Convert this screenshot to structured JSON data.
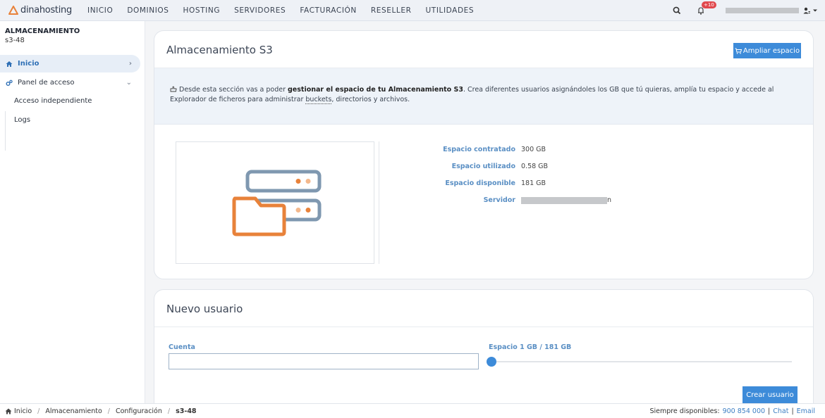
{
  "brand": {
    "name": "dinahosting"
  },
  "nav": {
    "items": [
      {
        "label": "INICIO"
      },
      {
        "label": "DOMINIOS"
      },
      {
        "label": "HOSTING"
      },
      {
        "label": "SERVIDORES"
      },
      {
        "label": "FACTURACIÓN"
      },
      {
        "label": "RESELLER"
      },
      {
        "label": "UTILIDADES"
      }
    ],
    "notifications_badge": "+10"
  },
  "sidebar": {
    "title": "ALMACENAMIENTO",
    "subtitle": "s3-48",
    "items": [
      {
        "label": "Inicio",
        "icon": "home-icon",
        "active": true
      },
      {
        "label": "Panel de acceso",
        "icon": "cogs-icon",
        "expanded": true
      }
    ],
    "subitems": [
      {
        "label": "Acceso independiente"
      },
      {
        "label": "Logs"
      }
    ]
  },
  "storage_card": {
    "title": "Almacenamiento S3",
    "expand_button": "Ampliar espacio",
    "info": {
      "pre": "Desde esta sección vas a poder ",
      "bold": "gestionar el espacio de tu Almacenamiento S3",
      "mid": ". Crea diferentes usuarios asignándoles los GB que tú quieras, amplía tu espacio y accede al Explorador de ficheros para administrar ",
      "link": "buckets",
      "post": ", directorios y archivos."
    },
    "details": [
      {
        "label": "Espacio contratado",
        "value": "300 GB"
      },
      {
        "label": "Espacio utilizado",
        "value": "0.58 GB"
      },
      {
        "label": "Espacio disponible",
        "value": "181 GB"
      },
      {
        "label": "Servidor",
        "value": "n"
      }
    ]
  },
  "new_user_card": {
    "title": "Nuevo usuario",
    "account_label": "Cuenta",
    "account_value": "",
    "space_label": "Espacio 1 GB / 181 GB",
    "slider_value_gb": 1,
    "slider_max_gb": 181,
    "create_button": "Crear usuario"
  },
  "footer": {
    "breadcrumb": [
      "Inicio",
      "Almacenamiento",
      "Configuración",
      "s3-48"
    ],
    "available_label": "Siempre disponibles:",
    "phone": "900 854 000",
    "chat": "Chat",
    "email": "Email"
  },
  "colors": {
    "accent": "#3d8bd9",
    "label_blue": "#5a8fc4",
    "brand_orange": "#e8823a",
    "server_gray": "#7f98b0"
  }
}
